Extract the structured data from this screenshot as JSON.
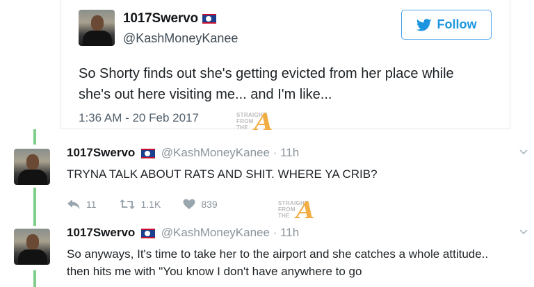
{
  "embed": {
    "display_name": "1017Swervo",
    "handle": "@KashMoneyKanee",
    "follow_label": "Follow",
    "tweet_text": "So Shorty finds out she's getting evicted from her place while she's out here visiting me... and I'm like...",
    "timestamp": "1:36 AM - 20 Feb 2017"
  },
  "watermark": {
    "line1": "STRAIGHT",
    "line2": "FROM",
    "line3": "THE",
    "letter": "A"
  },
  "replies": [
    {
      "display_name": "1017Swervo",
      "handle": "@KashMoneyKanee",
      "age": "· 11h",
      "text": "TRYNA TALK ABOUT RATS AND SHIT. WHERE YA CRIB?",
      "reply_count": "11",
      "retweet_count": "1.1K",
      "like_count": "839"
    },
    {
      "display_name": "1017Swervo",
      "handle": "@KashMoneyKanee",
      "age": "· 11h",
      "text": "So anyways, It's time to take her to the airport and she catches a whole attitude.. then hits me with \"You know I don't have anywhere to go"
    }
  ],
  "colors": {
    "twitter_blue": "#1b95e0",
    "thread_line": "#7fcf8a",
    "watermark_accent": "#f2a93b"
  }
}
